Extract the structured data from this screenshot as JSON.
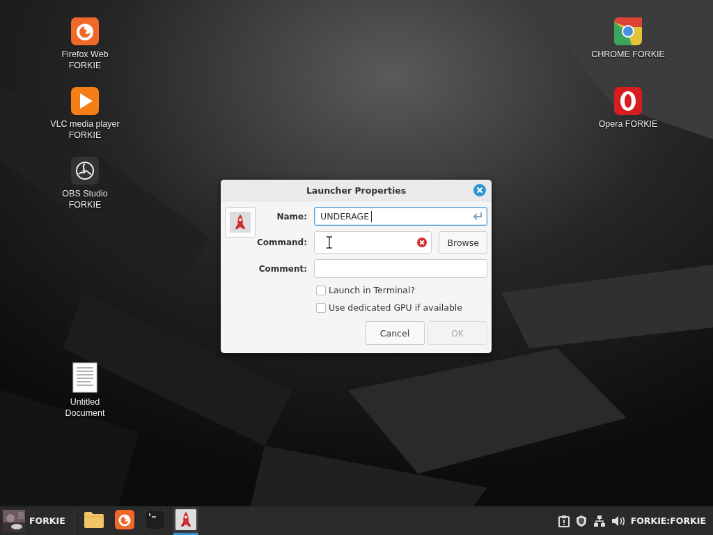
{
  "desktop_icons_left": [
    {
      "label": "Firefox Web FORKIE"
    },
    {
      "label": "VLC media player FORKIE"
    },
    {
      "label": "OBS Studio FORKIE"
    },
    {
      "label": "Untitled Document"
    }
  ],
  "desktop_icons_right": [
    {
      "label": "CHROME FORKIE"
    },
    {
      "label": "Opera FORKIE"
    }
  ],
  "dialog": {
    "title": "Launcher Properties",
    "fields": [
      {
        "label": "Name:",
        "value": "UNDERAGE",
        "focused": true,
        "kind": "enter"
      },
      {
        "label": "Command:",
        "focused": false,
        "kind": "browse",
        "button": "Browse"
      },
      {
        "label": "Comment:",
        "focused": false,
        "kind": "plain"
      }
    ],
    "checkboxes": [
      {
        "label": "Launch in Terminal?",
        "checked": false
      },
      {
        "label": "Use dedicated GPU if available",
        "checked": false
      }
    ],
    "buttons": [
      {
        "label": "Cancel",
        "disabled": false
      },
      {
        "label": "OK",
        "disabled": true
      }
    ]
  },
  "taskbar": {
    "user": "FORKIE",
    "launchers": [
      {
        "selected": false
      },
      {
        "selected": false
      },
      {
        "selected": false
      },
      {
        "selected": true
      }
    ],
    "tray_label": "FORKIE:FORKIE"
  }
}
